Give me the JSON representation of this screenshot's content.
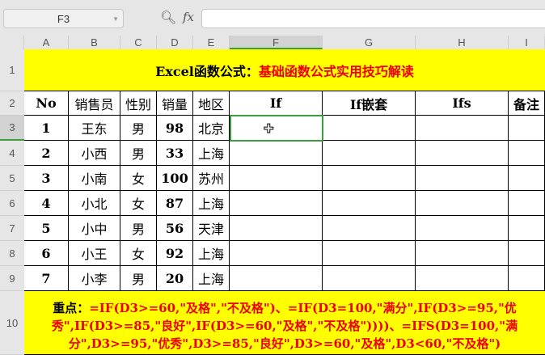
{
  "namebox": "F3",
  "fx_label": "fx",
  "columns": [
    "A",
    "B",
    "C",
    "D",
    "E",
    "F",
    "G",
    "H",
    "I"
  ],
  "rows": [
    "1",
    "2",
    "3",
    "4",
    "5",
    "6",
    "7",
    "8",
    "9",
    "10"
  ],
  "title": {
    "black": "Excel函数公式：",
    "red": "基础函数公式实用技巧解读"
  },
  "headers": [
    "No",
    "销售员",
    "性别",
    "销量",
    "地区",
    "If",
    "If嵌套",
    "Ifs",
    "备注"
  ],
  "data": [
    [
      "1",
      "王东",
      "男",
      "98",
      "北京"
    ],
    [
      "2",
      "小西",
      "男",
      "33",
      "上海"
    ],
    [
      "3",
      "小南",
      "女",
      "100",
      "苏州"
    ],
    [
      "4",
      "小北",
      "女",
      "87",
      "上海"
    ],
    [
      "5",
      "小中",
      "男",
      "56",
      "天津"
    ],
    [
      "6",
      "小王",
      "女",
      "92",
      "上海"
    ],
    [
      "7",
      "小李",
      "男",
      "20",
      "上海"
    ]
  ],
  "note": {
    "label": "重点：",
    "text": "=IF(D3>=60,\"及格\",\"不及格\")、=IF(D3=100,\"满分\",IF(D3>=95,\"优秀\",IF(D3>=85,\"良好\",IF(D3>=60,\"及格\",\"不及格\"))))、=IFS(D3=100,\"满分\",D3>=95,\"优秀\",D3>=85,\"良好\",D3>=60,\"及格\",D3<60,\"不及格\")"
  }
}
